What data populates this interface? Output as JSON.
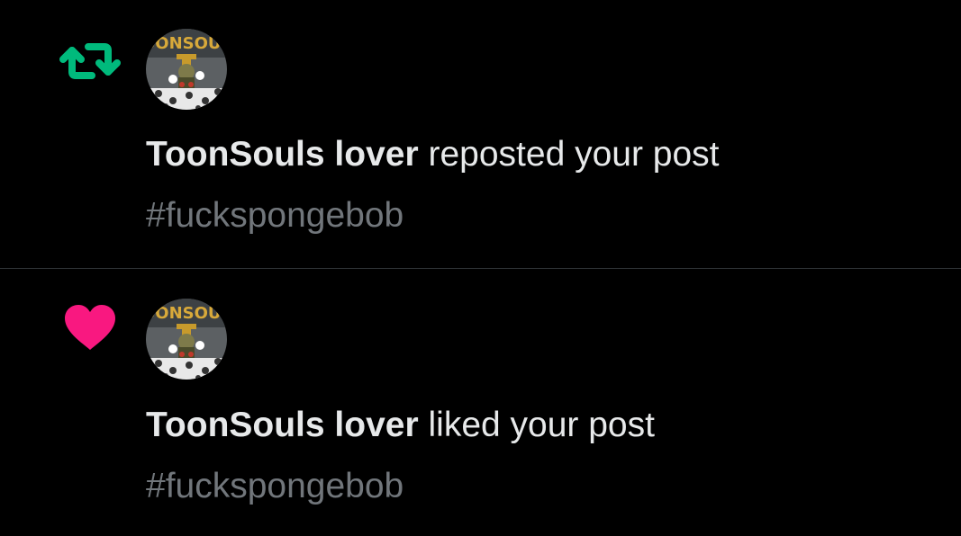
{
  "notifications": [
    {
      "type": "repost",
      "icon": "repost-icon",
      "icon_color": "#00ba7c",
      "username": "ToonSouls lover",
      "action": "reposted your post",
      "post_text": "#fuckspongebob",
      "avatar_text": "OONSOUL"
    },
    {
      "type": "like",
      "icon": "heart-icon",
      "icon_color": "#f91880",
      "username": "ToonSouls lover",
      "action": "liked your post",
      "post_text": "#fuckspongebob",
      "avatar_text": "OONSOUL"
    }
  ],
  "colors": {
    "background": "#000000",
    "primary_text": "#e7e9ea",
    "secondary_text": "#71767b",
    "divider": "#2f3336"
  }
}
